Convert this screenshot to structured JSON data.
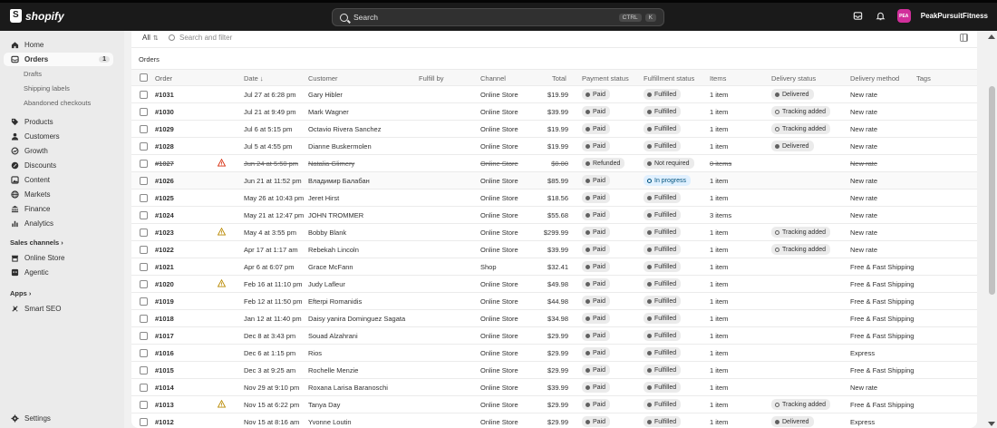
{
  "topbar": {
    "brand": "shopify",
    "search_label": "Search",
    "kbd_ctrl": "CTRL",
    "kbd_k": "K",
    "avatar_initials": "PEA",
    "store_name": "PeakPursuitFitness"
  },
  "sidebar": {
    "items": [
      {
        "label": "Home",
        "icon": "home-icon"
      },
      {
        "label": "Orders",
        "icon": "orders-icon",
        "badge": "1"
      },
      {
        "label": "Drafts"
      },
      {
        "label": "Shipping labels"
      },
      {
        "label": "Abandoned checkouts"
      },
      {
        "label": "Products",
        "icon": "tag-icon"
      },
      {
        "label": "Customers",
        "icon": "person-icon"
      },
      {
        "label": "Growth",
        "icon": "growth-icon"
      },
      {
        "label": "Discounts",
        "icon": "discount-icon"
      },
      {
        "label": "Content",
        "icon": "content-icon"
      },
      {
        "label": "Markets",
        "icon": "globe-icon"
      },
      {
        "label": "Finance",
        "icon": "bank-icon"
      },
      {
        "label": "Analytics",
        "icon": "bar-chart-icon"
      }
    ],
    "sales_channels_label": "Sales channels",
    "online_store_label": "Online Store",
    "agentic_label": "Agentic",
    "apps_label": "Apps",
    "smart_seo_label": "Smart SEO",
    "settings_label": "Settings"
  },
  "filters": {
    "all_tab": "All",
    "search_placeholder": "Search and filter",
    "section_title": "Orders"
  },
  "table": {
    "headers": {
      "order": "Order",
      "date": "Date ↓",
      "customer": "Customer",
      "fulfill_by": "Fulfill by",
      "channel": "Channel",
      "total": "Total",
      "payment": "Payment status",
      "fulfillment": "Fulfillment status",
      "items": "Items",
      "delivery_status": "Delivery status",
      "delivery_method": "Delivery method",
      "tags": "Tags"
    },
    "rows": [
      {
        "order": "#1031",
        "date": "Jul 27 at 6:28 pm",
        "customer": "Gary Hibler",
        "channel": "Online Store",
        "total": "$19.99",
        "payment": "Paid",
        "fulfillment": "Fulfilled",
        "items": "1 item",
        "delivery_status": "Delivered",
        "delivery_method": "New rate",
        "warn": false
      },
      {
        "order": "#1030",
        "date": "Jul 21 at 9:49 pm",
        "customer": "Mark Wagner",
        "channel": "Online Store",
        "total": "$39.99",
        "payment": "Paid",
        "fulfillment": "Fulfilled",
        "items": "1 item",
        "delivery_status": "Tracking added",
        "delivery_method": "New rate",
        "warn": false
      },
      {
        "order": "#1029",
        "date": "Jul 6 at 5:15 pm",
        "customer": "Octavio Rivera Sanchez",
        "channel": "Online Store",
        "total": "$19.99",
        "payment": "Paid",
        "fulfillment": "Fulfilled",
        "items": "1 item",
        "delivery_status": "Tracking added",
        "delivery_method": "New rate",
        "warn": false
      },
      {
        "order": "#1028",
        "date": "Jul 5 at 4:55 pm",
        "customer": "Dianne Buskermolen",
        "channel": "Online Store",
        "total": "$19.99",
        "payment": "Paid",
        "fulfillment": "Fulfilled",
        "items": "1 item",
        "delivery_status": "Delivered",
        "delivery_method": "New rate",
        "warn": false
      },
      {
        "order": "#1027",
        "date": "Jun 24 at 5:50 pm",
        "customer": "Natalia Glimery",
        "channel": "Online Store",
        "total": "$0.00",
        "payment": "Refunded",
        "fulfillment": "Not required",
        "items": "0 items",
        "delivery_status": "",
        "delivery_method": "New rate",
        "warn": true,
        "warn_color": "#d72c0d",
        "struck": true
      },
      {
        "order": "#1026",
        "date": "Jun 21 at 11:52 pm",
        "customer": "Владимир Балабан",
        "channel": "Online Store",
        "total": "$85.99",
        "payment": "Paid",
        "fulfillment": "In progress",
        "items": "1 item",
        "delivery_status": "",
        "delivery_method": "New rate",
        "warn": false,
        "highlight": true
      },
      {
        "order": "#1025",
        "date": "May 26 at 10:43 pm",
        "customer": "Jeret Hirst",
        "channel": "Online Store",
        "total": "$18.56",
        "payment": "Paid",
        "fulfillment": "Fulfilled",
        "items": "1 item",
        "delivery_status": "",
        "delivery_method": "New rate",
        "warn": false
      },
      {
        "order": "#1024",
        "date": "May 21 at 12:47 pm",
        "customer": "JOHN TROMMER",
        "channel": "Online Store",
        "total": "$55.68",
        "payment": "Paid",
        "fulfillment": "Fulfilled",
        "items": "3 items",
        "delivery_status": "",
        "delivery_method": "New rate",
        "warn": false
      },
      {
        "order": "#1023",
        "date": "May 4 at 3:55 pm",
        "customer": "Bobby Blank",
        "channel": "Online Store",
        "total": "$299.99",
        "payment": "Paid",
        "fulfillment": "Fulfilled",
        "items": "1 item",
        "delivery_status": "Tracking added",
        "delivery_method": "New rate",
        "warn": true,
        "warn_color": "#b98900"
      },
      {
        "order": "#1022",
        "date": "Apr 17 at 1:17 am",
        "customer": "Rebekah Lincoln",
        "channel": "Online Store",
        "total": "$39.99",
        "payment": "Paid",
        "fulfillment": "Fulfilled",
        "items": "1 item",
        "delivery_status": "Tracking added",
        "delivery_method": "New rate",
        "warn": false
      },
      {
        "order": "#1021",
        "date": "Apr 6 at 6:07 pm",
        "customer": "Grace McFann",
        "channel": "Shop",
        "total": "$32.41",
        "payment": "Paid",
        "fulfillment": "Fulfilled",
        "items": "1 item",
        "delivery_status": "",
        "delivery_method": "Free & Fast Shipping",
        "warn": false
      },
      {
        "order": "#1020",
        "date": "Feb 16 at 11:10 pm",
        "customer": "Judy Lafleur",
        "channel": "Online Store",
        "total": "$49.98",
        "payment": "Paid",
        "fulfillment": "Fulfilled",
        "items": "1 item",
        "delivery_status": "",
        "delivery_method": "Free & Fast Shipping",
        "warn": true,
        "warn_color": "#b98900"
      },
      {
        "order": "#1019",
        "date": "Feb 12 at 11:50 pm",
        "customer": "Efterpi Romanidis",
        "channel": "Online Store",
        "total": "$44.98",
        "payment": "Paid",
        "fulfillment": "Fulfilled",
        "items": "1 item",
        "delivery_status": "",
        "delivery_method": "Free & Fast Shipping",
        "warn": false
      },
      {
        "order": "#1018",
        "date": "Jan 12 at 11:40 pm",
        "customer": "Daisy yanira Dominguez Sagata",
        "channel": "Online Store",
        "total": "$34.98",
        "payment": "Paid",
        "fulfillment": "Fulfilled",
        "items": "1 item",
        "delivery_status": "",
        "delivery_method": "Free & Fast Shipping",
        "warn": false
      },
      {
        "order": "#1017",
        "date": "Dec 8 at 3:43 pm",
        "customer": "Souad Alzahrani",
        "channel": "Online Store",
        "total": "$29.99",
        "payment": "Paid",
        "fulfillment": "Fulfilled",
        "items": "1 item",
        "delivery_status": "",
        "delivery_method": "Free & Fast Shipping",
        "warn": false
      },
      {
        "order": "#1016",
        "date": "Dec 6 at 1:15 pm",
        "customer": "Rios",
        "channel": "Online Store",
        "total": "$29.99",
        "payment": "Paid",
        "fulfillment": "Fulfilled",
        "items": "1 item",
        "delivery_status": "",
        "delivery_method": "Express",
        "warn": false
      },
      {
        "order": "#1015",
        "date": "Dec 3 at 9:25 am",
        "customer": "Rochelle Menzie",
        "channel": "Online Store",
        "total": "$29.99",
        "payment": "Paid",
        "fulfillment": "Fulfilled",
        "items": "1 item",
        "delivery_status": "",
        "delivery_method": "Free & Fast Shipping",
        "warn": false
      },
      {
        "order": "#1014",
        "date": "Nov 29 at 9:10 pm",
        "customer": "Roxana Larisa Baranoschi",
        "channel": "Online Store",
        "total": "$39.99",
        "payment": "Paid",
        "fulfillment": "Fulfilled",
        "items": "1 item",
        "delivery_status": "",
        "delivery_method": "New rate",
        "warn": false
      },
      {
        "order": "#1013",
        "date": "Nov 15 at 6:22 pm",
        "customer": "Tanya Day",
        "channel": "Online Store",
        "total": "$29.99",
        "payment": "Paid",
        "fulfillment": "Fulfilled",
        "items": "1 item",
        "delivery_status": "Tracking added",
        "delivery_method": "Free & Fast Shipping",
        "warn": true,
        "warn_color": "#b98900"
      },
      {
        "order": "#1012",
        "date": "Nov 15 at 8:16 am",
        "customer": "Yvonne Loutin",
        "channel": "Online Store",
        "total": "$29.99",
        "payment": "Paid",
        "fulfillment": "Fulfilled",
        "items": "1 item",
        "delivery_status": "Delivered",
        "delivery_method": "Express",
        "warn": false
      }
    ]
  }
}
